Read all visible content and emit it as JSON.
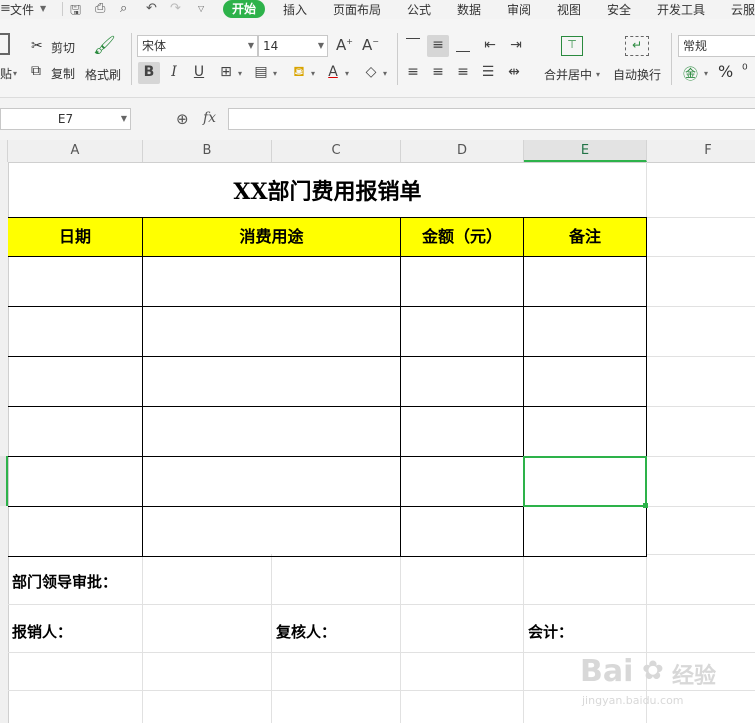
{
  "menubar": {
    "file_label": "文件",
    "tabs": [
      "开始",
      "插入",
      "页面布局",
      "公式",
      "数据",
      "审阅",
      "视图",
      "安全",
      "开发工具",
      "云服"
    ]
  },
  "ribbon": {
    "paste_label": "贴",
    "cut_label": "剪切",
    "copy_label": "复制",
    "format_painter_label": "格式刷",
    "font_name": "宋体",
    "font_size": "14",
    "merge_center_label": "合并居中",
    "wrap_text_label": "自动换行",
    "number_format": "常规",
    "percent_symbol": "%"
  },
  "formula_bar": {
    "cell_ref": "E7",
    "fx_label": "fx",
    "value": ""
  },
  "columns": [
    "A",
    "B",
    "C",
    "D",
    "E",
    "F"
  ],
  "selected_column": "E",
  "sheet": {
    "title": "XX部门费用报销单",
    "headers": [
      "日期",
      "消费用途",
      "金额（元）",
      "备注"
    ],
    "approval_label": "部门领导审批：",
    "reimburser_label": "报销人：",
    "reviewer_label": "复核人：",
    "accountant_label": "会计："
  },
  "watermark": {
    "brand": "Bai",
    "brand2": "经验",
    "url": "jingyan.baidu.com"
  },
  "colors": {
    "accent_green": "#2db24a",
    "header_fill": "#ffff00"
  }
}
